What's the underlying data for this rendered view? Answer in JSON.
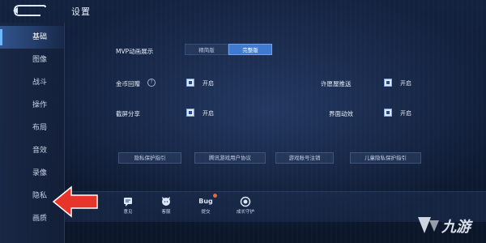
{
  "header": {
    "title": "设置"
  },
  "sidebar": {
    "items": [
      {
        "label": "基础",
        "active": true
      },
      {
        "label": "图像",
        "active": false
      },
      {
        "label": "战斗",
        "active": false
      },
      {
        "label": "操作",
        "active": false
      },
      {
        "label": "布局",
        "active": false
      },
      {
        "label": "音效",
        "active": false
      },
      {
        "label": "录像",
        "active": false
      },
      {
        "label": "隐私",
        "active": false
      },
      {
        "label": "画质",
        "active": false
      }
    ]
  },
  "main": {
    "mvp": {
      "label": "MVP动画展示",
      "options": [
        "精简版",
        "完整版"
      ],
      "selected": "完整版"
    },
    "toggles": [
      {
        "label": "金币回赠",
        "value": "开启",
        "has_help": true
      },
      {
        "label": "许愿屋推送",
        "value": "开启",
        "has_help": false
      },
      {
        "label": "截屏分享",
        "value": "开启",
        "has_help": false
      },
      {
        "label": "界面动效",
        "value": "开启",
        "has_help": false
      }
    ],
    "links": [
      "隐私保护指引",
      "腾讯游戏用户协议",
      "游戏账号注销",
      "儿童隐私保护指引"
    ]
  },
  "bottom_bar": {
    "items": [
      {
        "label": "意见",
        "icon": "feedback-icon"
      },
      {
        "label": "客服",
        "icon": "service-icon"
      },
      {
        "label": "提交",
        "icon": "bug-icon",
        "badge_text": "Bug"
      },
      {
        "label": "成长守护",
        "icon": "guardian-icon"
      }
    ]
  },
  "watermark": {
    "text": "九游"
  },
  "colors": {
    "accent": "#3f7ad0",
    "arrow": "#e8352b",
    "background": "#0d1a33"
  }
}
